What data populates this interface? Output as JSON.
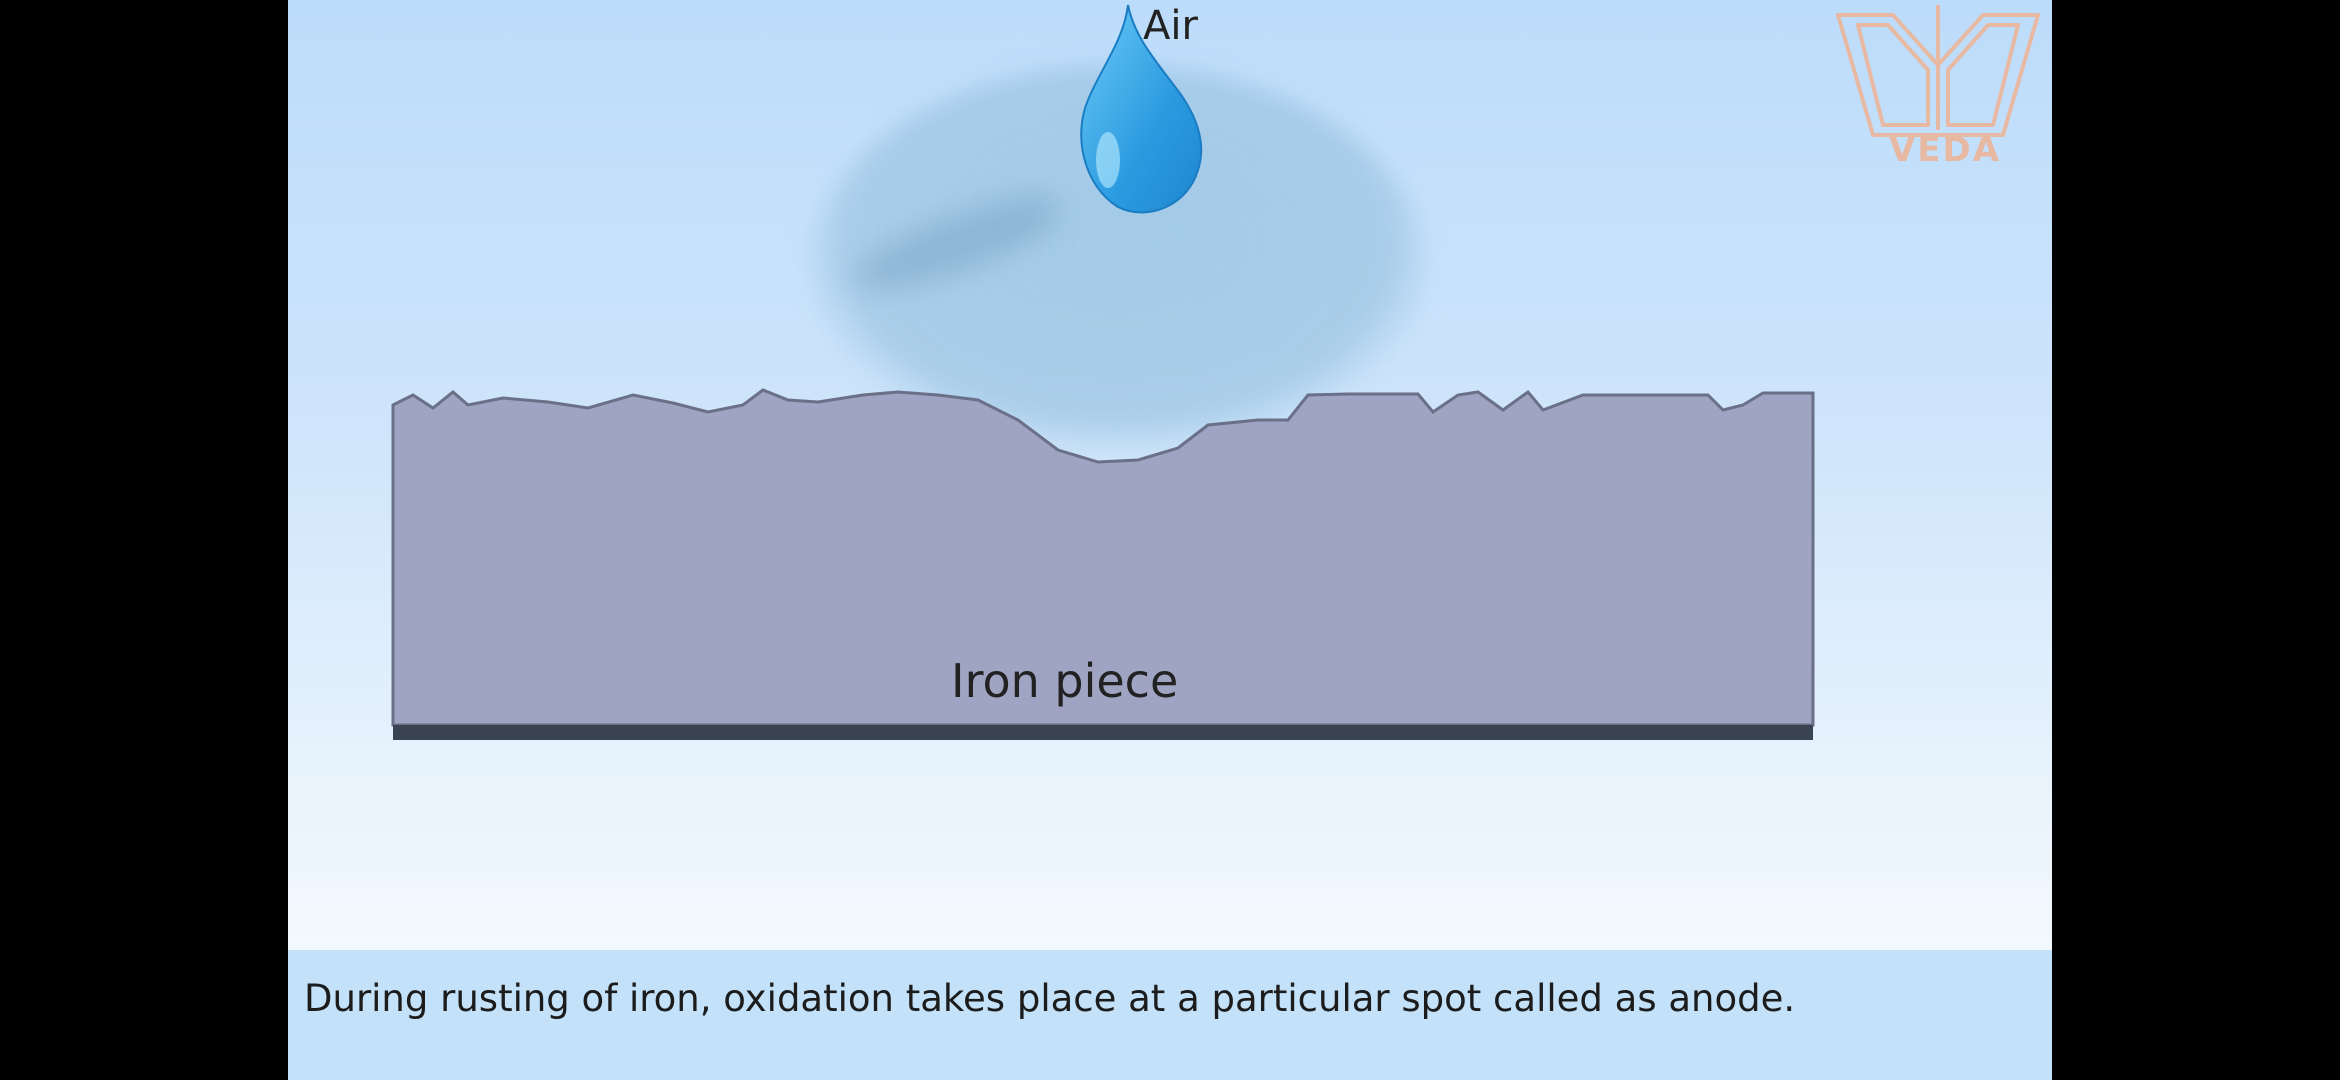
{
  "scene": {
    "air_label": "Air",
    "iron_label": "Iron piece"
  },
  "logo": {
    "text": "VEDA",
    "color": "#e8b9a2",
    "icon": "book-icon"
  },
  "caption": {
    "text": "During rusting of iron, oxidation takes place at a particular spot called as anode."
  },
  "colors": {
    "sky_top": "#bcdcfb",
    "water_drop": "#3aa8e6",
    "water_blob": "#8fbfe0",
    "iron": "#9ea4c2",
    "iron_base": "#3a4352",
    "caption_bar": "#c3e1f8"
  }
}
